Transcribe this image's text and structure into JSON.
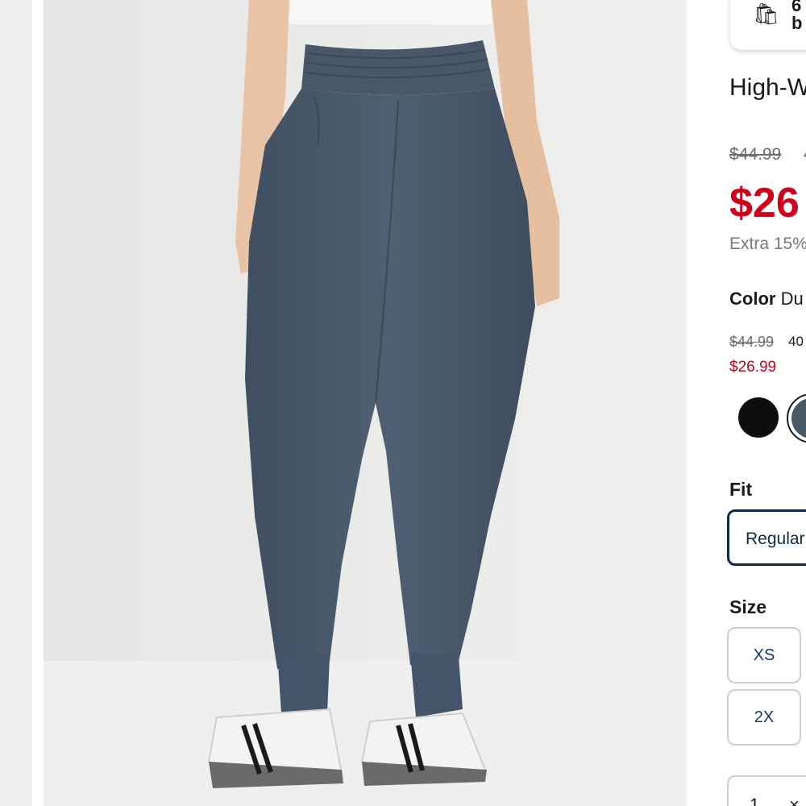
{
  "promo": {
    "icon": "shopping-bags-icon",
    "text": "6\nb"
  },
  "product": {
    "title": "High-W",
    "old_price": "$44.99",
    "old_price_tail": "4",
    "sale_price": "$26",
    "extra": "Extra 15%"
  },
  "color": {
    "label": "Color",
    "value": "Du",
    "swatch_old_price": "$44.99",
    "swatch_pct": "40",
    "swatch_sale_price": "$26.99",
    "swatches": [
      {
        "name": "black",
        "hex": "#0e0e0e"
      },
      {
        "name": "navy",
        "hex": "#4a5866",
        "selected": true
      }
    ]
  },
  "fit": {
    "label": "Fit",
    "selected": "Regular"
  },
  "size": {
    "label": "Size",
    "options": [
      "XS",
      "2X"
    ]
  },
  "quantity": {
    "value": "1",
    "remove": "×"
  },
  "colors": {
    "sale_red": "#d0021b",
    "navy": "#0d2a4a",
    "pant": "#4a5a6b"
  }
}
